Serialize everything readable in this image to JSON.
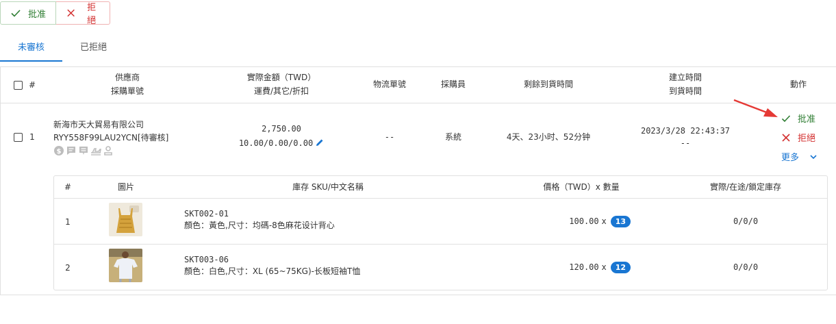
{
  "toolbar": {
    "approve_label": "批准",
    "reject_label": "拒絕"
  },
  "tabs": [
    {
      "label": "未審核",
      "active": true
    },
    {
      "label": "已拒絕",
      "active": false
    }
  ],
  "table": {
    "headers": {
      "index": "#",
      "supplier_line1": "供應商",
      "supplier_line2": "採購單號",
      "amount_line1": "實際金額（TWD）",
      "amount_line2": "運費/其它/折扣",
      "tracking": "物流單號",
      "buyer": "採購員",
      "remaining": "剩餘到貨時間",
      "time_line1": "建立時間",
      "time_line2": "到貨時間",
      "action": "動作"
    },
    "row": {
      "index": "1",
      "supplier": "新海市天大貿易有限公司",
      "order_no": "RYY558F99LAU2YCN",
      "status": "[待審核]",
      "amount": "2,750.00",
      "fees": "10.00/0.00/0.00",
      "tracking": "--",
      "buyer": "系統",
      "remaining": "4天、23小时、52分钟",
      "created": "2023/3/28 22:43:37",
      "arrival": "--",
      "actions": {
        "approve": "批准",
        "reject": "拒絕",
        "more": "更多"
      }
    }
  },
  "sub_table": {
    "headers": {
      "index": "#",
      "image": "圖片",
      "sku": "庫存 SKU/中文名稱",
      "price_qty": "價格（TWD）x 數量",
      "stock": "實際/在途/鎖定庫存"
    },
    "rows": [
      {
        "index": "1",
        "sku": "SKT002-01",
        "name": "顏色：黃色,尺寸：均碼-8色麻花设计背心",
        "price": "100.00",
        "x": "x",
        "qty": "13",
        "stock": "0/0/0"
      },
      {
        "index": "2",
        "sku": "SKT003-06",
        "name": "顏色：白色,尺寸：XL (65~75KG)-长板短袖T恤",
        "price": "120.00",
        "x": "x",
        "qty": "12",
        "stock": "0/0/0"
      }
    ]
  },
  "colors": {
    "primary": "#1976d2",
    "success": "#2e7d32",
    "danger": "#d32f2f",
    "annotation": "#e53935"
  }
}
